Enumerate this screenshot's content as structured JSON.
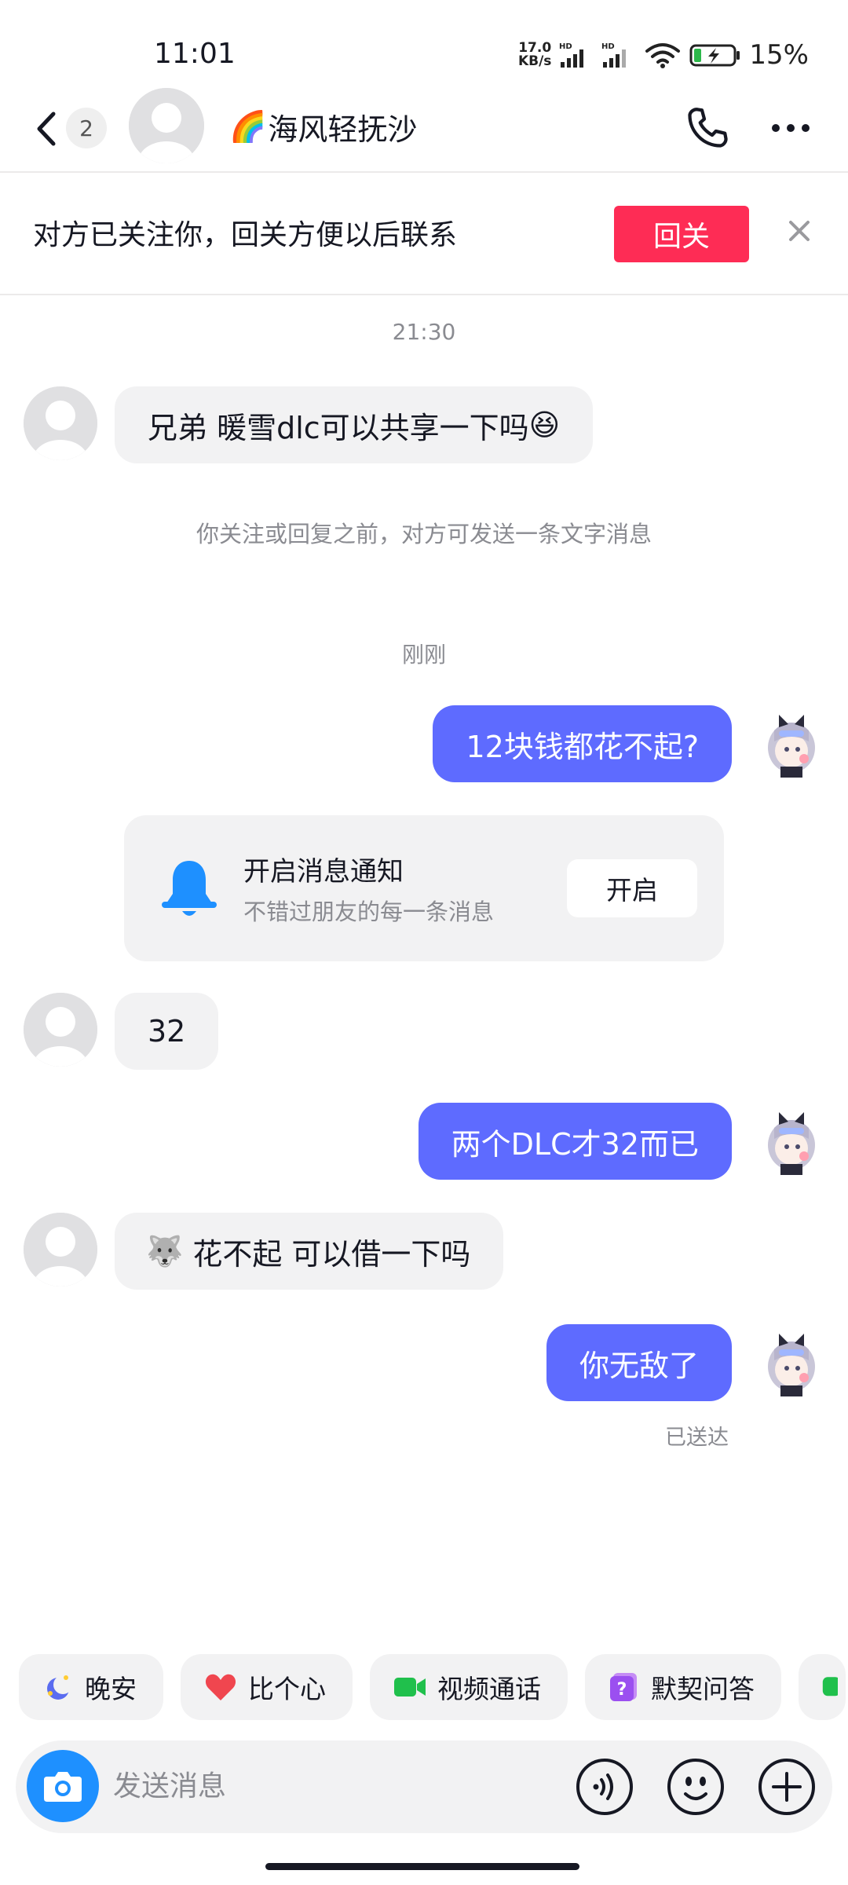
{
  "status_bar": {
    "time": "11:01",
    "net_speed_value": "17.0",
    "net_speed_unit": "KB/s",
    "battery_percent": "15%"
  },
  "header": {
    "unread_count": "2",
    "contact_name": "海风轻抚沙",
    "name_emoji": "🌈"
  },
  "follow_banner": {
    "text": "对方已关注你，回关方便以后联系",
    "follow_back_label": "回关"
  },
  "messages": {
    "time_1": "21:30",
    "m1_text": "兄弟 暖雪dlc可以共享一下吗",
    "m1_emoji": "😆",
    "system_note": "你关注或回复之前，对方可发送一条文字消息",
    "time_2": "刚刚",
    "m2_text": "12块钱都花不起?",
    "m3_text": "32",
    "m4_text": "两个DLC才32而已",
    "m5_text": "花不起 可以借一下吗",
    "m5_emoji": "🐺",
    "m6_text": "你无敌了",
    "delivered_label": "已送达"
  },
  "notify_card": {
    "title": "开启消息通知",
    "subtitle": "不错过朋友的每一条消息",
    "button_label": "开启"
  },
  "quick_replies": [
    {
      "label": "晚安",
      "icon": "moon-icon"
    },
    {
      "label": "比个心",
      "icon": "heart-icon"
    },
    {
      "label": "视频通话",
      "icon": "video-camera-icon"
    },
    {
      "label": "默契问答",
      "icon": "question-card-icon"
    }
  ],
  "input": {
    "placeholder": "发送消息"
  },
  "colors": {
    "accent": "#fe2c55",
    "outgoing_bubble": "#5e6bff",
    "incoming_bubble": "#f2f2f3",
    "camera": "#1e90ff"
  }
}
